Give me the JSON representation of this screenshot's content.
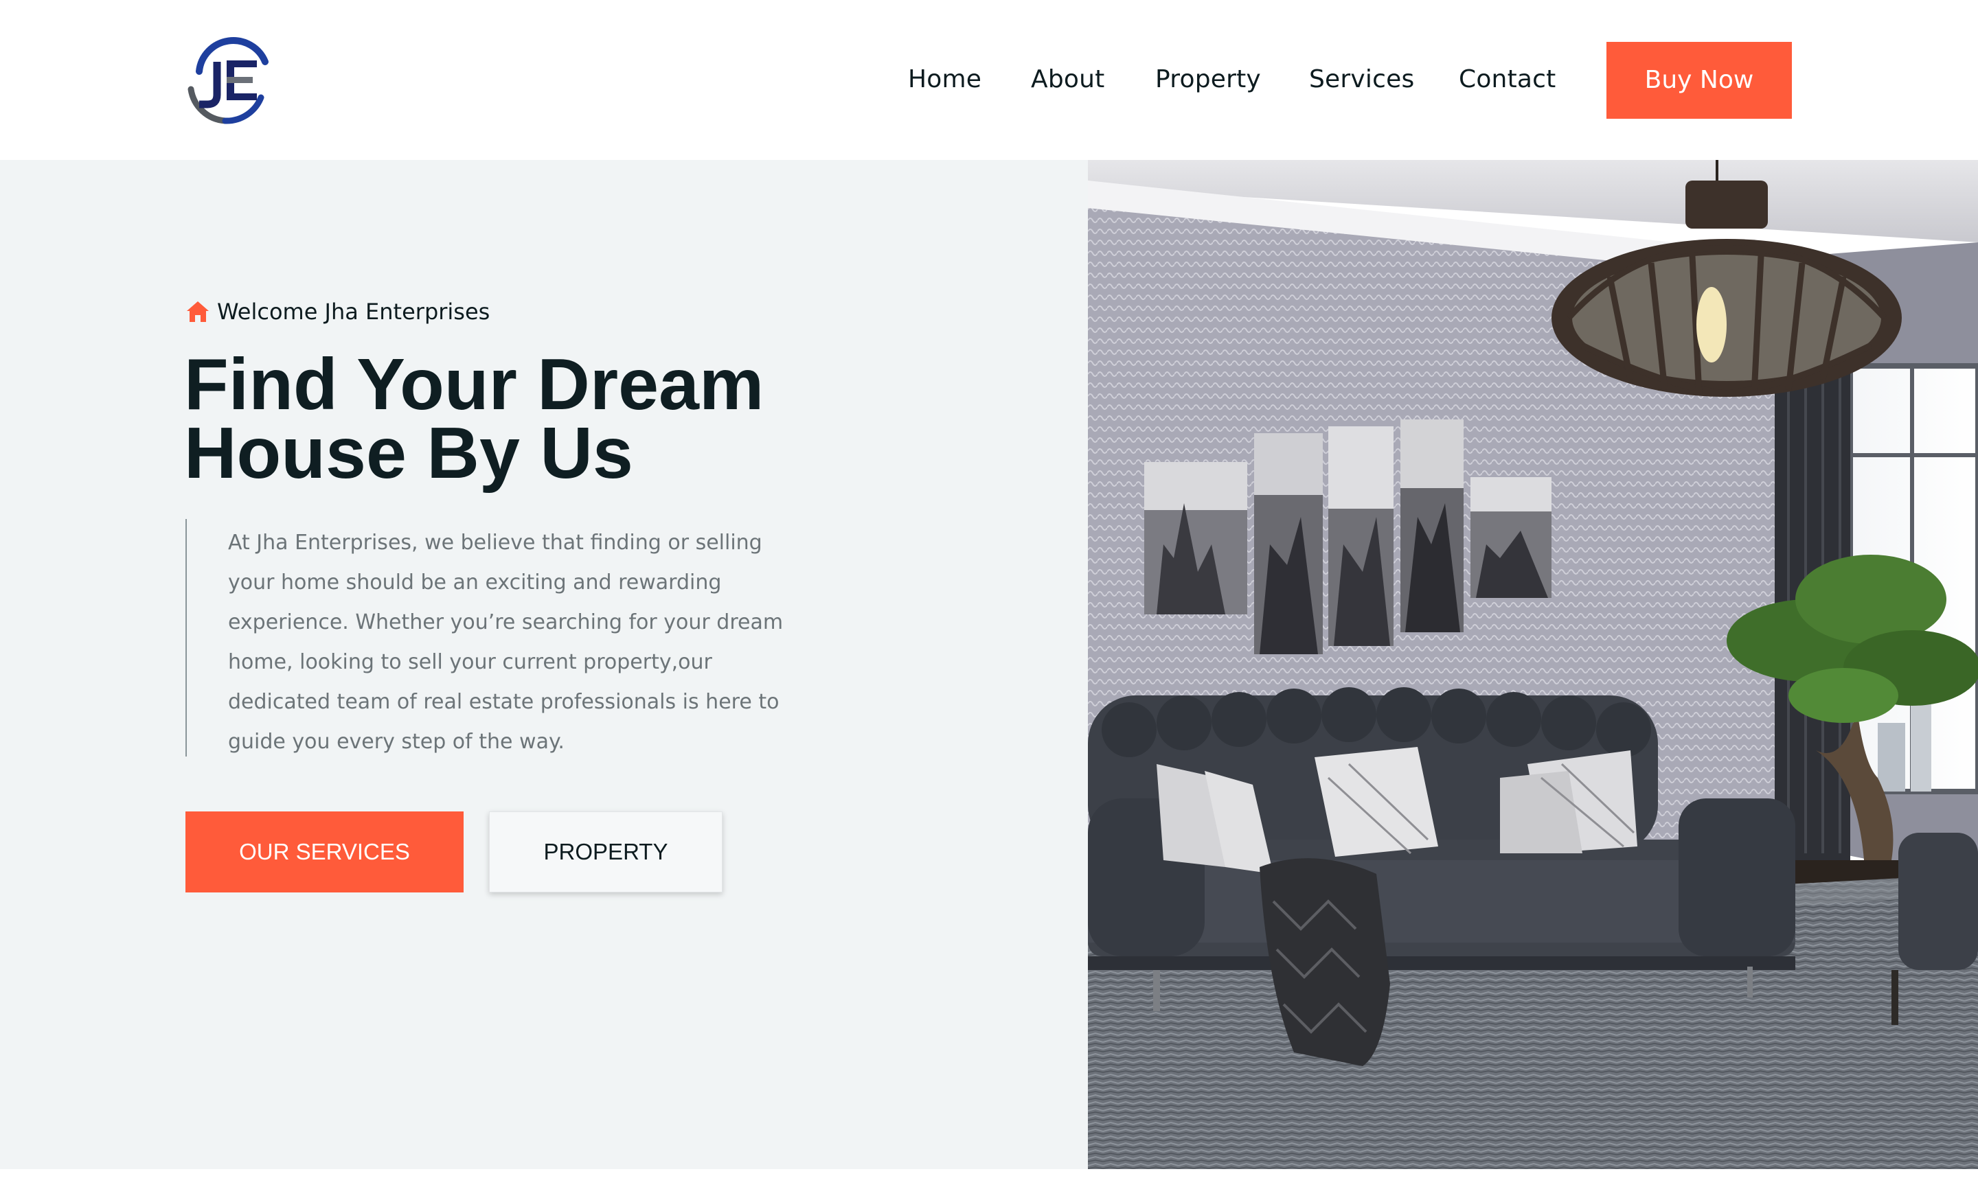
{
  "brand": {
    "logo_letters": "JE",
    "accent_color": "#ff5b3a",
    "logo_blue": "#1e3f9e"
  },
  "nav": {
    "items": [
      {
        "label": "Home"
      },
      {
        "label": "About"
      },
      {
        "label": "Property"
      },
      {
        "label": "Services"
      },
      {
        "label": "Contact"
      }
    ],
    "cta_label": "Buy Now"
  },
  "hero": {
    "welcome_icon": "home-icon",
    "welcome_text": "Welcome Jha Enterprises",
    "title_line1": "Find Your Dream",
    "title_line2": "House By Us",
    "description": "At Jha Enterprises, we believe that finding or selling your home should be an exciting and rewarding experience. Whether you’re searching for your dream home, looking to sell your current property,our dedicated team of real estate professionals is here to guide you every step of the way.",
    "primary_button": "OUR SERVICES",
    "secondary_button": "PROPERTY",
    "image_subject": "living-room-interior"
  }
}
